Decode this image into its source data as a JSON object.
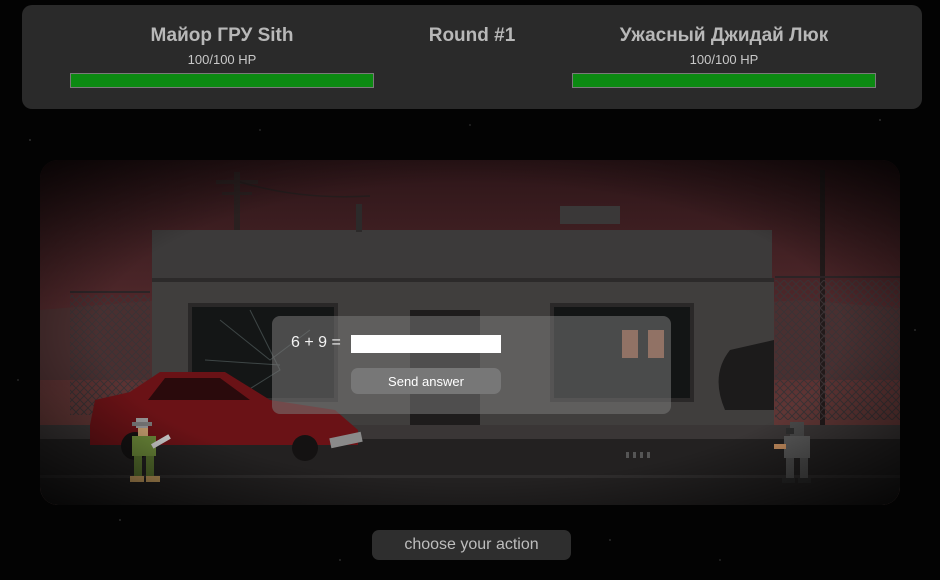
{
  "hud": {
    "player": {
      "name": "Майор ГРУ Sith",
      "hp_text": "100/100 HP",
      "hp_fraction": 1.0
    },
    "round_label": "Round #1",
    "opponent": {
      "name": "Ужасный Джидай Люк",
      "hp_text": "100/100 HP",
      "hp_fraction": 1.0
    }
  },
  "question": {
    "equation": "6 + 9 =",
    "answer_value": "",
    "answer_placeholder": "",
    "send_label": "Send answer"
  },
  "status": {
    "text": "choose your action"
  },
  "colors": {
    "hud_background": "#2a2a2a",
    "hp_fill": "#0c8a12",
    "sky_top": "#3a1e22",
    "sky_bottom": "#7a4a44"
  }
}
